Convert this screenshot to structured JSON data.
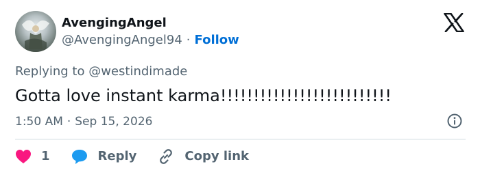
{
  "author": {
    "display_name": "AvengingAngel",
    "handle": "@AvengingAngel94",
    "separator": "·",
    "follow_label": "Follow"
  },
  "reply_context": {
    "prefix": "Replying to",
    "mention": "@westindimade"
  },
  "tweet": {
    "text": "Gotta love instant karma!!!!!!!!!!!!!!!!!!!!!!!!!!",
    "time": "1:50 AM",
    "separator": "·",
    "date": "Sep 15, 2026"
  },
  "actions": {
    "like_count": "1",
    "reply_label": "Reply",
    "copy_link_label": "Copy link"
  },
  "icons": {
    "logo": "x-logo-icon",
    "info": "info-icon",
    "like": "heart-icon",
    "reply": "speech-bubble-icon",
    "copy": "link-icon"
  },
  "colors": {
    "text": "#0f1419",
    "secondary": "#536471",
    "follow": "#006fd6",
    "like": "#f91880",
    "reply": "#1d9bf0",
    "divider": "#cfd9de"
  }
}
